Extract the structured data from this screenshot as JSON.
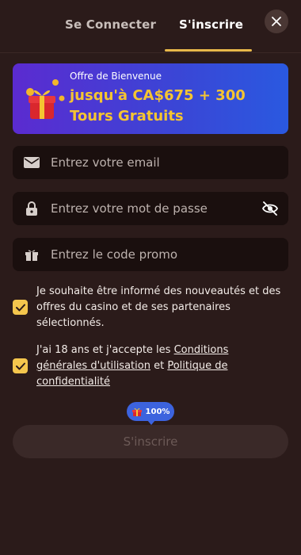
{
  "tabs": {
    "login": "Se Connecter",
    "register": "S'inscrire"
  },
  "banner": {
    "eyebrow": "Offre de Bienvenue",
    "title": "jusqu'à CA$675 + 300 Tours Gratuits"
  },
  "fields": {
    "email_placeholder": "Entrez votre email",
    "password_placeholder": "Entrez votre mot de passe",
    "promo_placeholder": "Entrez le code promo"
  },
  "consents": {
    "newsletter": "Je souhaite être informé des nouveautés et des offres du casino et de ses partenaires sélectionnés.",
    "terms_prefix": "J'ai 18 ans et j'accepte les ",
    "terms_link": "Conditions générales d'utilisation",
    "terms_middle": " et ",
    "privacy_link": "Politique de confidentialité"
  },
  "progress_badge": "100%",
  "submit_label": "S'inscrire",
  "colors": {
    "accent": "#e8b84a",
    "checkbox": "#f4c64d",
    "badge": "#3c63de",
    "banner_title": "#f5c531"
  },
  "icons": [
    "close-icon",
    "gift-icon",
    "envelope-icon",
    "lock-icon",
    "eye-off-icon",
    "gift-small-icon",
    "check-icon"
  ]
}
